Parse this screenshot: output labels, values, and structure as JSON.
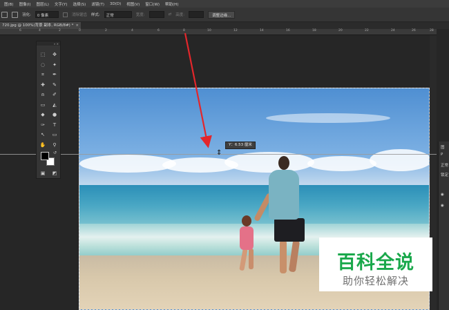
{
  "menu": [
    "图(B)",
    "图像(I)",
    "图层(L)",
    "文字(Y)",
    "选择(S)",
    "滤镜(T)",
    "3D(D)",
    "视图(V)",
    "窗口(W)",
    "帮助(H)"
  ],
  "options": {
    "feather_label": "羽化:",
    "feather_value": "0 像素",
    "antialias_label": "消除锯齿",
    "style_label": "样式:",
    "style_value": "正常",
    "width_label": "宽度:",
    "height_label": "高度:",
    "refine_button": "调整边缘..."
  },
  "tab": {
    "title": "720.jpg @ 100%(背景 副本, RGB/8#) *",
    "close": "×"
  },
  "ruler_ticks": [
    "6",
    "4",
    "2",
    "0",
    "2",
    "4",
    "6",
    "8",
    "10",
    "12",
    "14",
    "16",
    "18",
    "20",
    "22",
    "24",
    "26",
    "28"
  ],
  "tools_panel_header": "»  ×",
  "tools": [
    "⬚",
    "✥",
    "◌",
    "✦",
    "⌗",
    "✒",
    "✚",
    "✎",
    "⍝",
    "✐",
    "▭",
    "◭",
    "◆",
    "●",
    "✑",
    "T",
    "↖",
    "▭",
    "✋",
    "⚲",
    "▣",
    "◩"
  ],
  "guide_tooltip": "Y：6.53 厘米",
  "dock_items": [
    "图",
    "P",
    "正常",
    "锁定"
  ],
  "watermark": {
    "title": "百科全说",
    "subtitle": "助你轻松解决"
  },
  "colors": {
    "arrow": "#e3262b",
    "watermark_green": "#1aa84b"
  }
}
